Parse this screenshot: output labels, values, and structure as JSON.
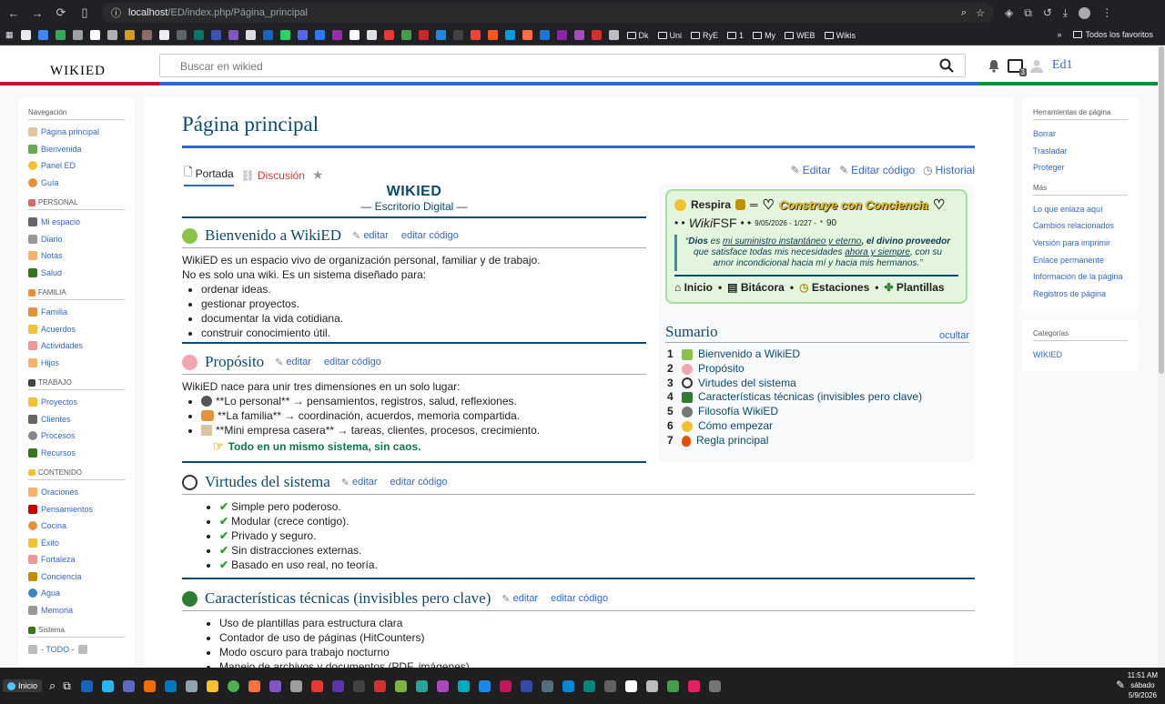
{
  "browser": {
    "url_host": "localhost",
    "url_path": "/ED/index.php/Página_principal",
    "bookmarks": [
      "Dk",
      "Uni",
      "RyE",
      "1",
      "My",
      "WEB",
      "Wikis"
    ],
    "other_bookmarks": "Todos los favoritos",
    "tab_badge": "3"
  },
  "site": {
    "logo": "WIKIED",
    "search_placeholder": "Buscar en wikied",
    "user": "Ed1",
    "colors": {
      "red": "#c8102e",
      "blue": "#3366cc",
      "green": "#0a8f3c"
    }
  },
  "left_nav": [
    {
      "title": "Navegación",
      "items": [
        {
          "label": "Página principal",
          "icon": "home-icon"
        },
        {
          "label": "Bienvenida",
          "icon": "sprout-icon"
        },
        {
          "label": "Panel ED",
          "icon": "clock-icon"
        },
        {
          "label": "Guía",
          "icon": "compass-icon"
        }
      ]
    },
    {
      "title": "PERSONAL",
      "items": [
        {
          "label": "Mi espacio",
          "icon": "person-icon"
        },
        {
          "label": "Diario",
          "icon": "notebook-icon"
        },
        {
          "label": "Notas",
          "icon": "note-icon"
        },
        {
          "label": "Salud",
          "icon": "leaf-icon"
        }
      ]
    },
    {
      "title": "FAMILIA",
      "items": [
        {
          "label": "Familia",
          "icon": "family-icon"
        },
        {
          "label": "Acuerdos",
          "icon": "heart-icon"
        },
        {
          "label": "Actividades",
          "icon": "calendar-icon"
        },
        {
          "label": "Hijos",
          "icon": "child-icon"
        }
      ]
    },
    {
      "title": "TRABAJO",
      "items": [
        {
          "label": "Proyectos",
          "icon": "folder-icon"
        },
        {
          "label": "Clientes",
          "icon": "people-icon"
        },
        {
          "label": "Procesos",
          "icon": "gear-icon"
        },
        {
          "label": "Recursos",
          "icon": "clover-icon"
        }
      ]
    },
    {
      "title": "CONTENIDO",
      "items": [
        {
          "label": "Oraciones",
          "icon": "pray-icon"
        },
        {
          "label": "Pensamientos",
          "icon": "heart-icon"
        },
        {
          "label": "Cocina",
          "icon": "bowl-icon"
        },
        {
          "label": "Éxito",
          "icon": "trophy-icon"
        },
        {
          "label": "Fortaleza",
          "icon": "muscle-icon"
        },
        {
          "label": "Conciencia",
          "icon": "sprout-icon"
        },
        {
          "label": "Agua",
          "icon": "drop-icon"
        },
        {
          "label": "Memoria",
          "icon": "book-icon"
        }
      ]
    },
    {
      "title": "Sistema",
      "items": [
        {
          "label": "- TODO -",
          "icon": "list-icon"
        }
      ]
    }
  ],
  "right_nav": {
    "tools_title": "Herramientas de página",
    "tools": [
      "Borrar",
      "Trasladar",
      "Proteger"
    ],
    "more_title": "Más",
    "more": [
      "Lo que enlaza aquí",
      "Cambios relacionados",
      "Versión para imprimir",
      "Enlace permanente",
      "Información de la página",
      "Registros de página"
    ],
    "cat_title": "Categorías",
    "cats": [
      "WIKIED"
    ]
  },
  "page": {
    "title": "Página principal",
    "tab_portada": "Portada",
    "tab_discusion": "Discusión",
    "action_editar": "Editar",
    "action_editar_codigo": "Editar código",
    "action_historial": "Historial",
    "head_title": "WIKIED",
    "head_sub": "— Escritorio Digital —",
    "edit": "editar",
    "edit_code": "editar código",
    "sections": [
      {
        "title": "Bienvenido a WikiED",
        "p1": "WikiED es un espacio vivo de organización personal, familiar y de trabajo.",
        "p2": "No es solo una wiki. Es un sistema diseñado para:",
        "items": [
          "ordenar ideas.",
          "gestionar proyectos.",
          "documentar la vida cotidiana.",
          "construir conocimiento útil."
        ]
      },
      {
        "title": "Propósito",
        "p1": "WikiED nace para unir tres dimensiones en un solo lugar:",
        "items": [
          "**Lo personal** → pensamientos, registros, salud, reflexiones.",
          "**La familia** → coordinación, acuerdos, memoria compartida.",
          "**Mini empresa casera** → tareas, clientes, procesos, crecimiento."
        ],
        "hint": "Todo en un mismo sistema, sin caos."
      },
      {
        "title": "Virtudes del sistema",
        "items": [
          "Simple pero poderoso.",
          "Modular (crece contigo).",
          "Privado y seguro.",
          "Sin distracciones externas.",
          "Basado en uso real, no teoría."
        ]
      },
      {
        "title": "Características técnicas (invisibles pero clave)",
        "items": [
          "Uso de plantillas para estructura clara",
          "Contador de uso de páginas (HitCounters)",
          "Modo oscuro para trabajo nocturno",
          "Manejo de archivos y documentos (PDF, imágenes)"
        ]
      }
    ]
  },
  "banner": {
    "respira": "Respira",
    "title": "Construye con Conciencia",
    "wiki_a": "Wiki",
    "wiki_b": "FSF",
    "date_info": "9/05/2026 - 1/227 -",
    "count": "90",
    "quote_dios": "Dios",
    "quote_es": " es ",
    "quote_link1": "mi suministro instantáneo y eterno",
    "quote_mid": ", el divino proveedor",
    "quote_rest": " que satisface todas mis necesidades ",
    "quote_link2": "ahora y siempre",
    "quote_end": ", con su amor incondicional hacia mí y hacia mis hermanos.",
    "nav": [
      "Inicio",
      "Bitácora",
      "Estaciones",
      "Plantillas"
    ]
  },
  "toc": {
    "title": "Sumario",
    "hide": "ocultar",
    "items": [
      {
        "num": "1",
        "label": "Bienvenido a WikiED"
      },
      {
        "num": "2",
        "label": "Propósito"
      },
      {
        "num": "3",
        "label": "Virtudes del sistema"
      },
      {
        "num": "4",
        "label": "Características técnicas (invisibles pero clave)"
      },
      {
        "num": "5",
        "label": "Filosofía WikiED"
      },
      {
        "num": "6",
        "label": "Cómo empezar"
      },
      {
        "num": "7",
        "label": "Regla principal"
      }
    ]
  },
  "taskbar": {
    "start": "Inicio",
    "time": "11:51 AM",
    "day": "sábado",
    "date": "5/9/2026"
  }
}
